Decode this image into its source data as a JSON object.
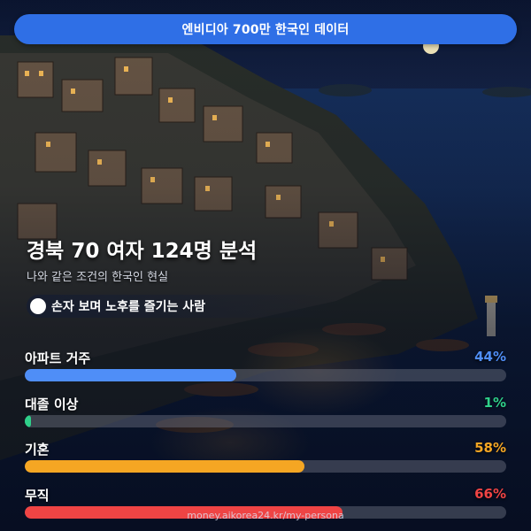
{
  "banner": {
    "text": "엔비디아 700만 한국인 데이터"
  },
  "header": {
    "title": "경북 70 여자 124명 분석",
    "subtitle": "나와 같은 조건의 한국인 현실",
    "tagline": "손자 보며 노후를 즐기는 사람"
  },
  "stats": [
    {
      "label": "아파트 거주",
      "value": "44%",
      "fraction": 0.44,
      "color": "#4f8ef7"
    },
    {
      "label": "대졸 이상",
      "value": "1%",
      "fraction": 0.01,
      "color": "#2fd08a"
    },
    {
      "label": "기혼",
      "value": "58%",
      "fraction": 0.58,
      "color": "#f5a623"
    },
    {
      "label": "무직",
      "value": "66%",
      "fraction": 0.66,
      "color": "#ef4444"
    }
  ],
  "footer": {
    "url": "money.aikorea24.kr/my-persona"
  }
}
